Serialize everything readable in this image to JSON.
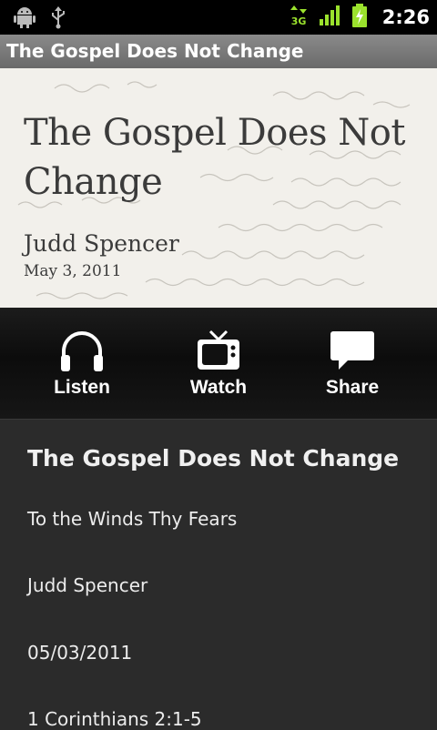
{
  "status_bar": {
    "left_icons": [
      "android-debug-icon",
      "usb-icon"
    ],
    "network": "3G",
    "time": "2:26"
  },
  "app": {
    "title": "The Gospel Does Not Change"
  },
  "banner": {
    "title": "The Gospel Does Not Change",
    "author": "Judd Spencer",
    "date": "May 3, 2011"
  },
  "actions": {
    "listen": "Listen",
    "watch": "Watch",
    "share": "Share"
  },
  "details": {
    "title": "The Gospel Does Not Change",
    "series": "To the Winds Thy Fears",
    "speaker": "Judd Spencer",
    "date": "05/03/2011",
    "scripture": "1 Corinthians 2:1-5"
  },
  "colors": {
    "accent_battery": "#9be22d",
    "network_arrows": "#9be22d"
  }
}
